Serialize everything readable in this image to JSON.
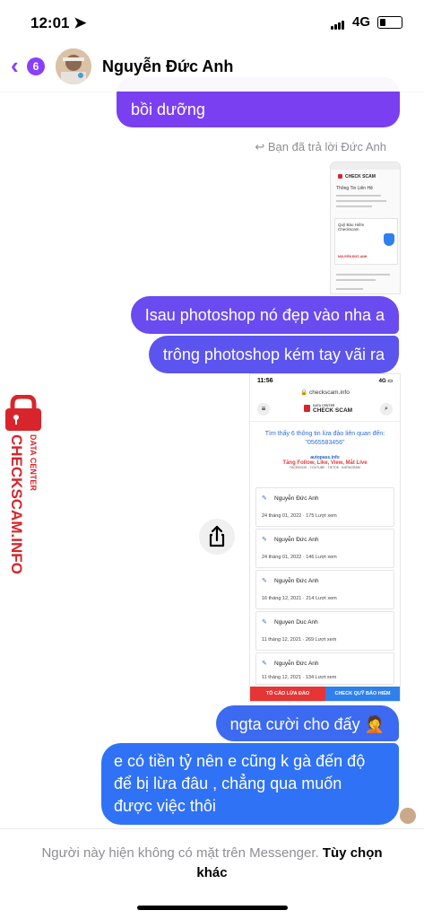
{
  "status": {
    "time": "12:01",
    "network": "4G"
  },
  "header": {
    "back_count": "6",
    "contact_name": "Nguyễn Đức Anh"
  },
  "messages": {
    "top_bubble": "bồi dưỡng",
    "reply_note": "Bạn đã trả lời Đức Anh",
    "b1": "Isau photoshop nó đẹp vào nha a",
    "b2": "trông photoshop kém tay vãi ra",
    "b3": "ngta cười cho đấy 🤦",
    "b4": "e có tiền tỷ nên e cũng k gà đến độ để bị lừa đâu , chẳng qua muốn được việc thôi"
  },
  "thumb1": {
    "logo": "CHECK SCAM",
    "label1": "Thông Tin Liên Hệ",
    "label2": "Quỹ Bảo Hiểm Checkscam",
    "label3": "NGUYỄN ĐỨC ANH"
  },
  "screenshot": {
    "time": "11:56",
    "network": "4G",
    "url": "checkscam.info",
    "logo_sub": "DATA CENTER",
    "logo_main": "CHECK SCAM",
    "find_text": "Tìm thấy 6 thông tin lừa đảo liên quan đến: \"0565583456\"",
    "ad_brand": "autopass.info",
    "ad_title": "Tăng Follow, Like, View, Mắt Live",
    "ad_small": "FACEBOOK · YOUTUBE · TIKTOK · INSTAGRAM",
    "entries": [
      {
        "name": "Nguyễn Đức Anh",
        "meta": "24 tháng 01, 2022 · 175 Lượt xem"
      },
      {
        "name": "Nguyễn Đức Anh",
        "meta": "24 tháng 01, 2022 · 146 Lượt xem"
      },
      {
        "name": "Nguyễn Đức Anh",
        "meta": "16 tháng 12, 2021 · 214 Lượt xem"
      },
      {
        "name": "Nguyen Duc Anh",
        "meta": "11 tháng 12, 2021 · 269 Lượt xem"
      },
      {
        "name": "Nguyễn Đức Anh",
        "meta": "11 tháng 12, 2021 · 134 Lượt xem"
      }
    ],
    "report_left": "TỐ CÁO LỪA ĐẢO",
    "report_right": "CHECK QUỸ BẢO HIỂM"
  },
  "watermark": {
    "main": "CHECKSCAM.INFO",
    "sub": "DATA CENTER"
  },
  "footer": {
    "text": "Người này hiện không có mặt trên Messenger.",
    "action": "Tùy chọn khác"
  },
  "colors": {
    "accent": "#8a3ffc",
    "bubble_purple": "#6a4bf0",
    "bubble_blue": "#2f72f5",
    "watermark_red": "#d8252b"
  }
}
